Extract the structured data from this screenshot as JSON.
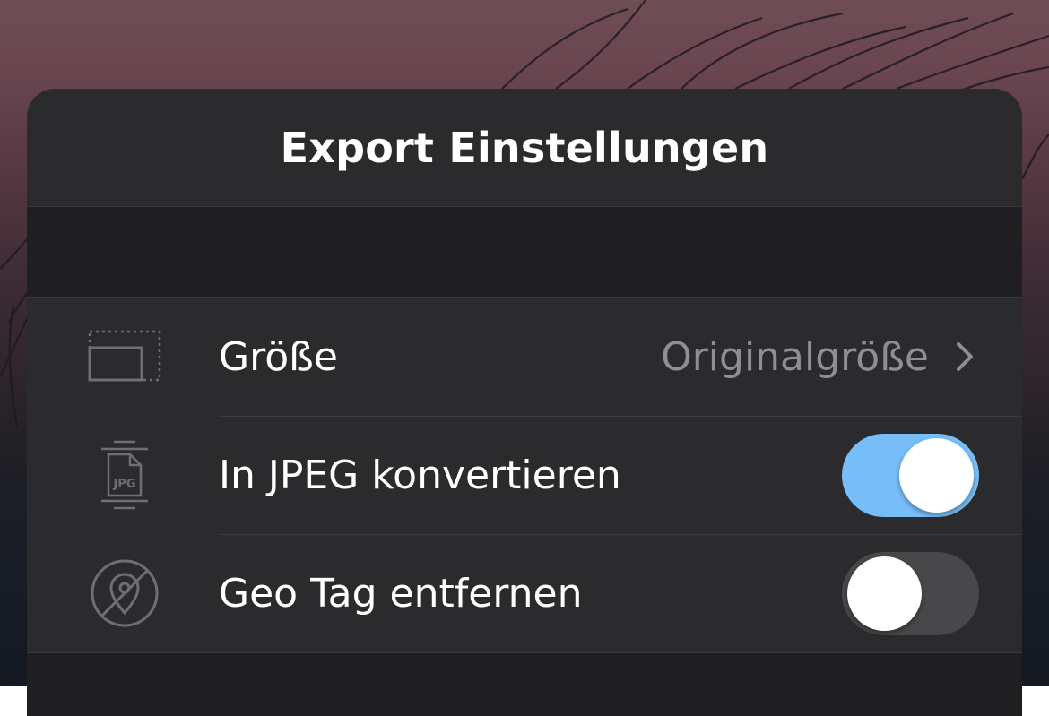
{
  "sheet": {
    "title": "Export Einstellungen"
  },
  "settings": {
    "size": {
      "label": "Größe",
      "value": "Originalgröße",
      "icon": "resize-frame-icon"
    },
    "convert_jpeg": {
      "label": "In JPEG konvertieren",
      "icon": "jpg-file-icon",
      "icon_text": "JPG",
      "enabled": true
    },
    "remove_geotag": {
      "label": "Geo Tag entfernen",
      "icon": "location-off-icon",
      "enabled": false
    }
  },
  "colors": {
    "sheet_background": "#2b2b2d",
    "separator": "#3a3a3c",
    "toggle_on": "#77bef9",
    "toggle_off": "#48484b",
    "secondary_text": "#8e8e93"
  }
}
